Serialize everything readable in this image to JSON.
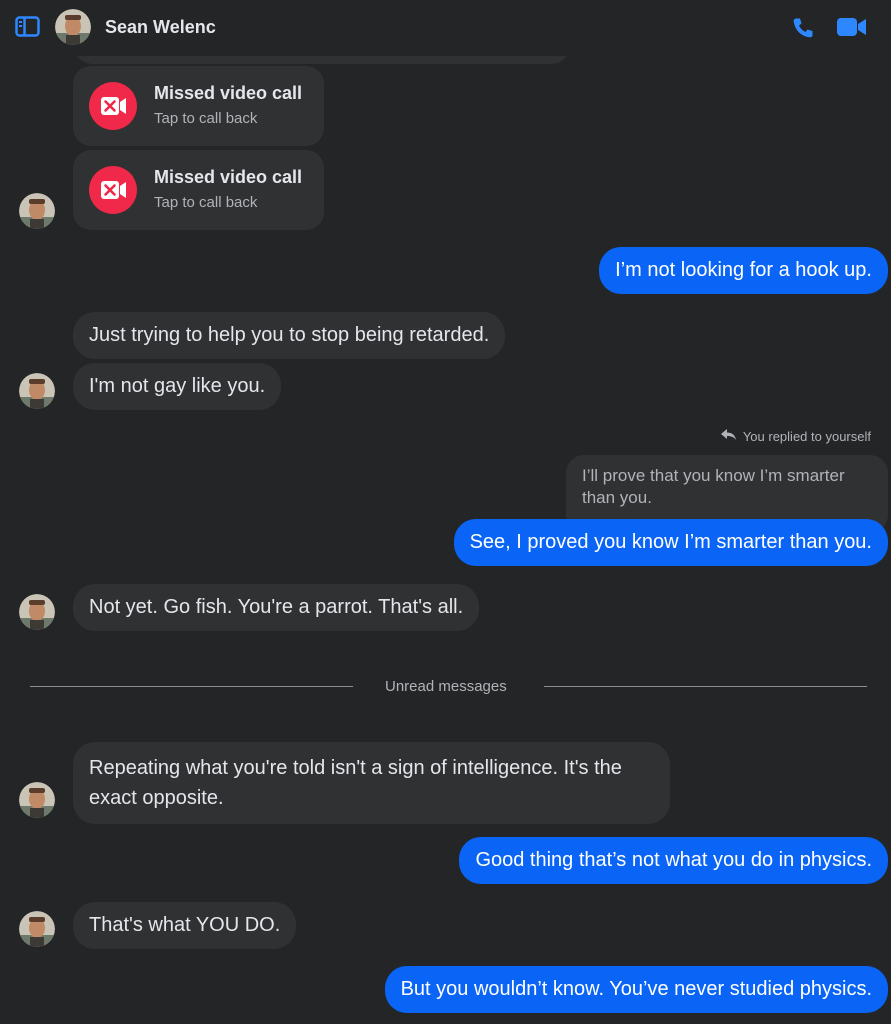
{
  "header": {
    "contact_name": "Sean Welenc",
    "sidebar_icon": "sidebar-icon",
    "phone_icon": "phone-icon",
    "video_icon": "video-camera-icon"
  },
  "missed_calls": [
    {
      "title": "Missed video call",
      "subtitle": "Tap to call back"
    },
    {
      "title": "Missed video call",
      "subtitle": "Tap to call back"
    }
  ],
  "messages": {
    "m1": "I’m not looking for a hook up.",
    "m2": "Just trying to help you to stop being retarded.",
    "m3": "I'm not gay like you.",
    "reply_note": "You replied to yourself",
    "quoted": "I’ll prove that you know I’m smarter than you.",
    "m4": "See, I proved you know I’m smarter than you.",
    "m5": "Not yet. Go fish. You're a parrot. That's all.",
    "m6": "Repeating what you're told isn't a sign of intelligence. It's the exact opposite.",
    "m7": "Good thing that’s not what you do in physics.",
    "m8": "That's what YOU DO.",
    "m9": "But you wouldn’t know.  You’ve never studied physics."
  },
  "divider": {
    "label": "Unread messages"
  },
  "colors": {
    "background": "#242527",
    "incoming_bubble": "#303133",
    "outgoing_bubble": "#0a65f7",
    "accent": "#2d88ff",
    "missed_call": "#f02849"
  }
}
